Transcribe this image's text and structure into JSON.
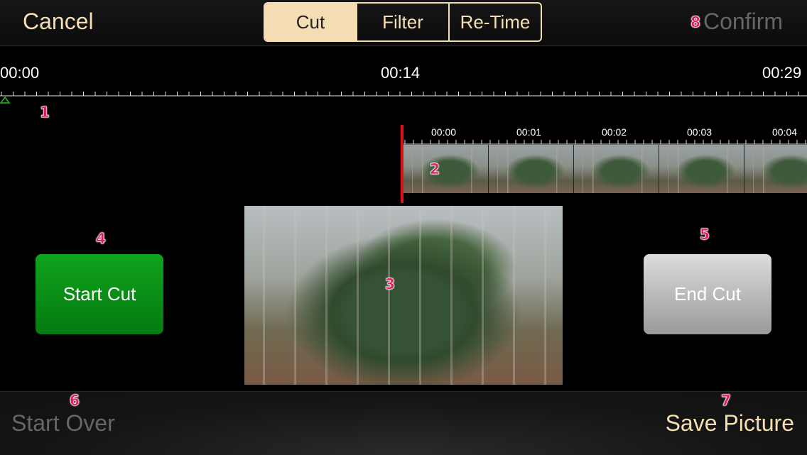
{
  "topbar": {
    "cancel_label": "Cancel",
    "tabs": [
      {
        "label": "Cut"
      },
      {
        "label": "Filter"
      },
      {
        "label": "Re-Time"
      }
    ],
    "selected_tab": "Cut",
    "confirm_label": "Confirm",
    "confirm_badge": "8"
  },
  "timeline": {
    "start": "00:00",
    "mid": "00:14",
    "end": "00:29",
    "badge": "1"
  },
  "filmstrip": {
    "labels": [
      "00:00",
      "00:01",
      "00:02",
      "00:03",
      "00:04"
    ],
    "badge": "2"
  },
  "preview": {
    "badge": "3"
  },
  "start_cut": {
    "label": "Start Cut",
    "badge": "4"
  },
  "end_cut": {
    "label": "End Cut",
    "badge": "5"
  },
  "bottombar": {
    "start_over_label": "Start Over",
    "start_over_badge": "6",
    "save_label": "Save Picture",
    "save_badge": "7"
  },
  "colors": {
    "accent": "#f5deb3",
    "green": "#0a9418",
    "red": "#e01010",
    "badge": "#e8175d"
  }
}
